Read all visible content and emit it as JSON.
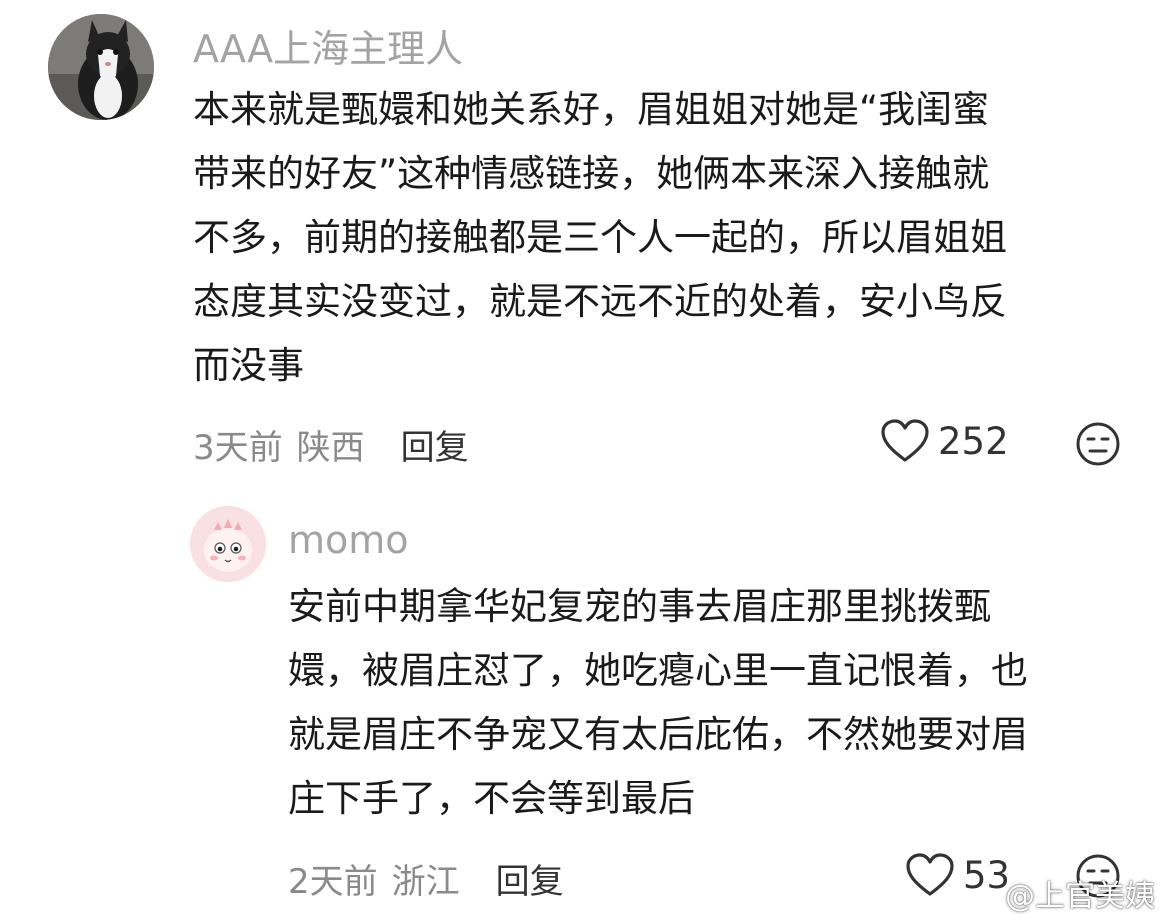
{
  "comments": [
    {
      "username": "AAA上海主理人",
      "avatar_icon": "cat-avatar",
      "lines": [
        "本来就是甄嬛和她关系好，眉姐姐对她是“我闺蜜",
        "带来的好友”这种情感链接，她俩本来深入接触就",
        "不多，前期的接触都是三个人一起的，所以眉姐姐",
        "态度其实没变过，就是不远不近的处着，安小鸟反",
        "而没事"
      ],
      "time": "3天前",
      "location": "陕西",
      "reply_label": "回复",
      "likes": "252"
    },
    {
      "username": "momo",
      "avatar_icon": "pink-dino-avatar",
      "lines": [
        "安前中期拿华妃复宠的事去眉庄那里挑拨甄",
        "嬛，被眉庄怼了，她吃瘪心里一直记恨着，也",
        "就是眉庄不争宠又有太后庇佑，不然她要对眉",
        "庄下手了，不会等到最后"
      ],
      "time": "2天前",
      "location": "浙江",
      "reply_label": "回复",
      "likes": "53"
    }
  ],
  "watermark": "@上官美姨",
  "colors": {
    "username": "#a3a3a3",
    "text": "#1a1a1a",
    "meta": "#8a8a8a",
    "avatar_pink": "#f9e1e3"
  }
}
